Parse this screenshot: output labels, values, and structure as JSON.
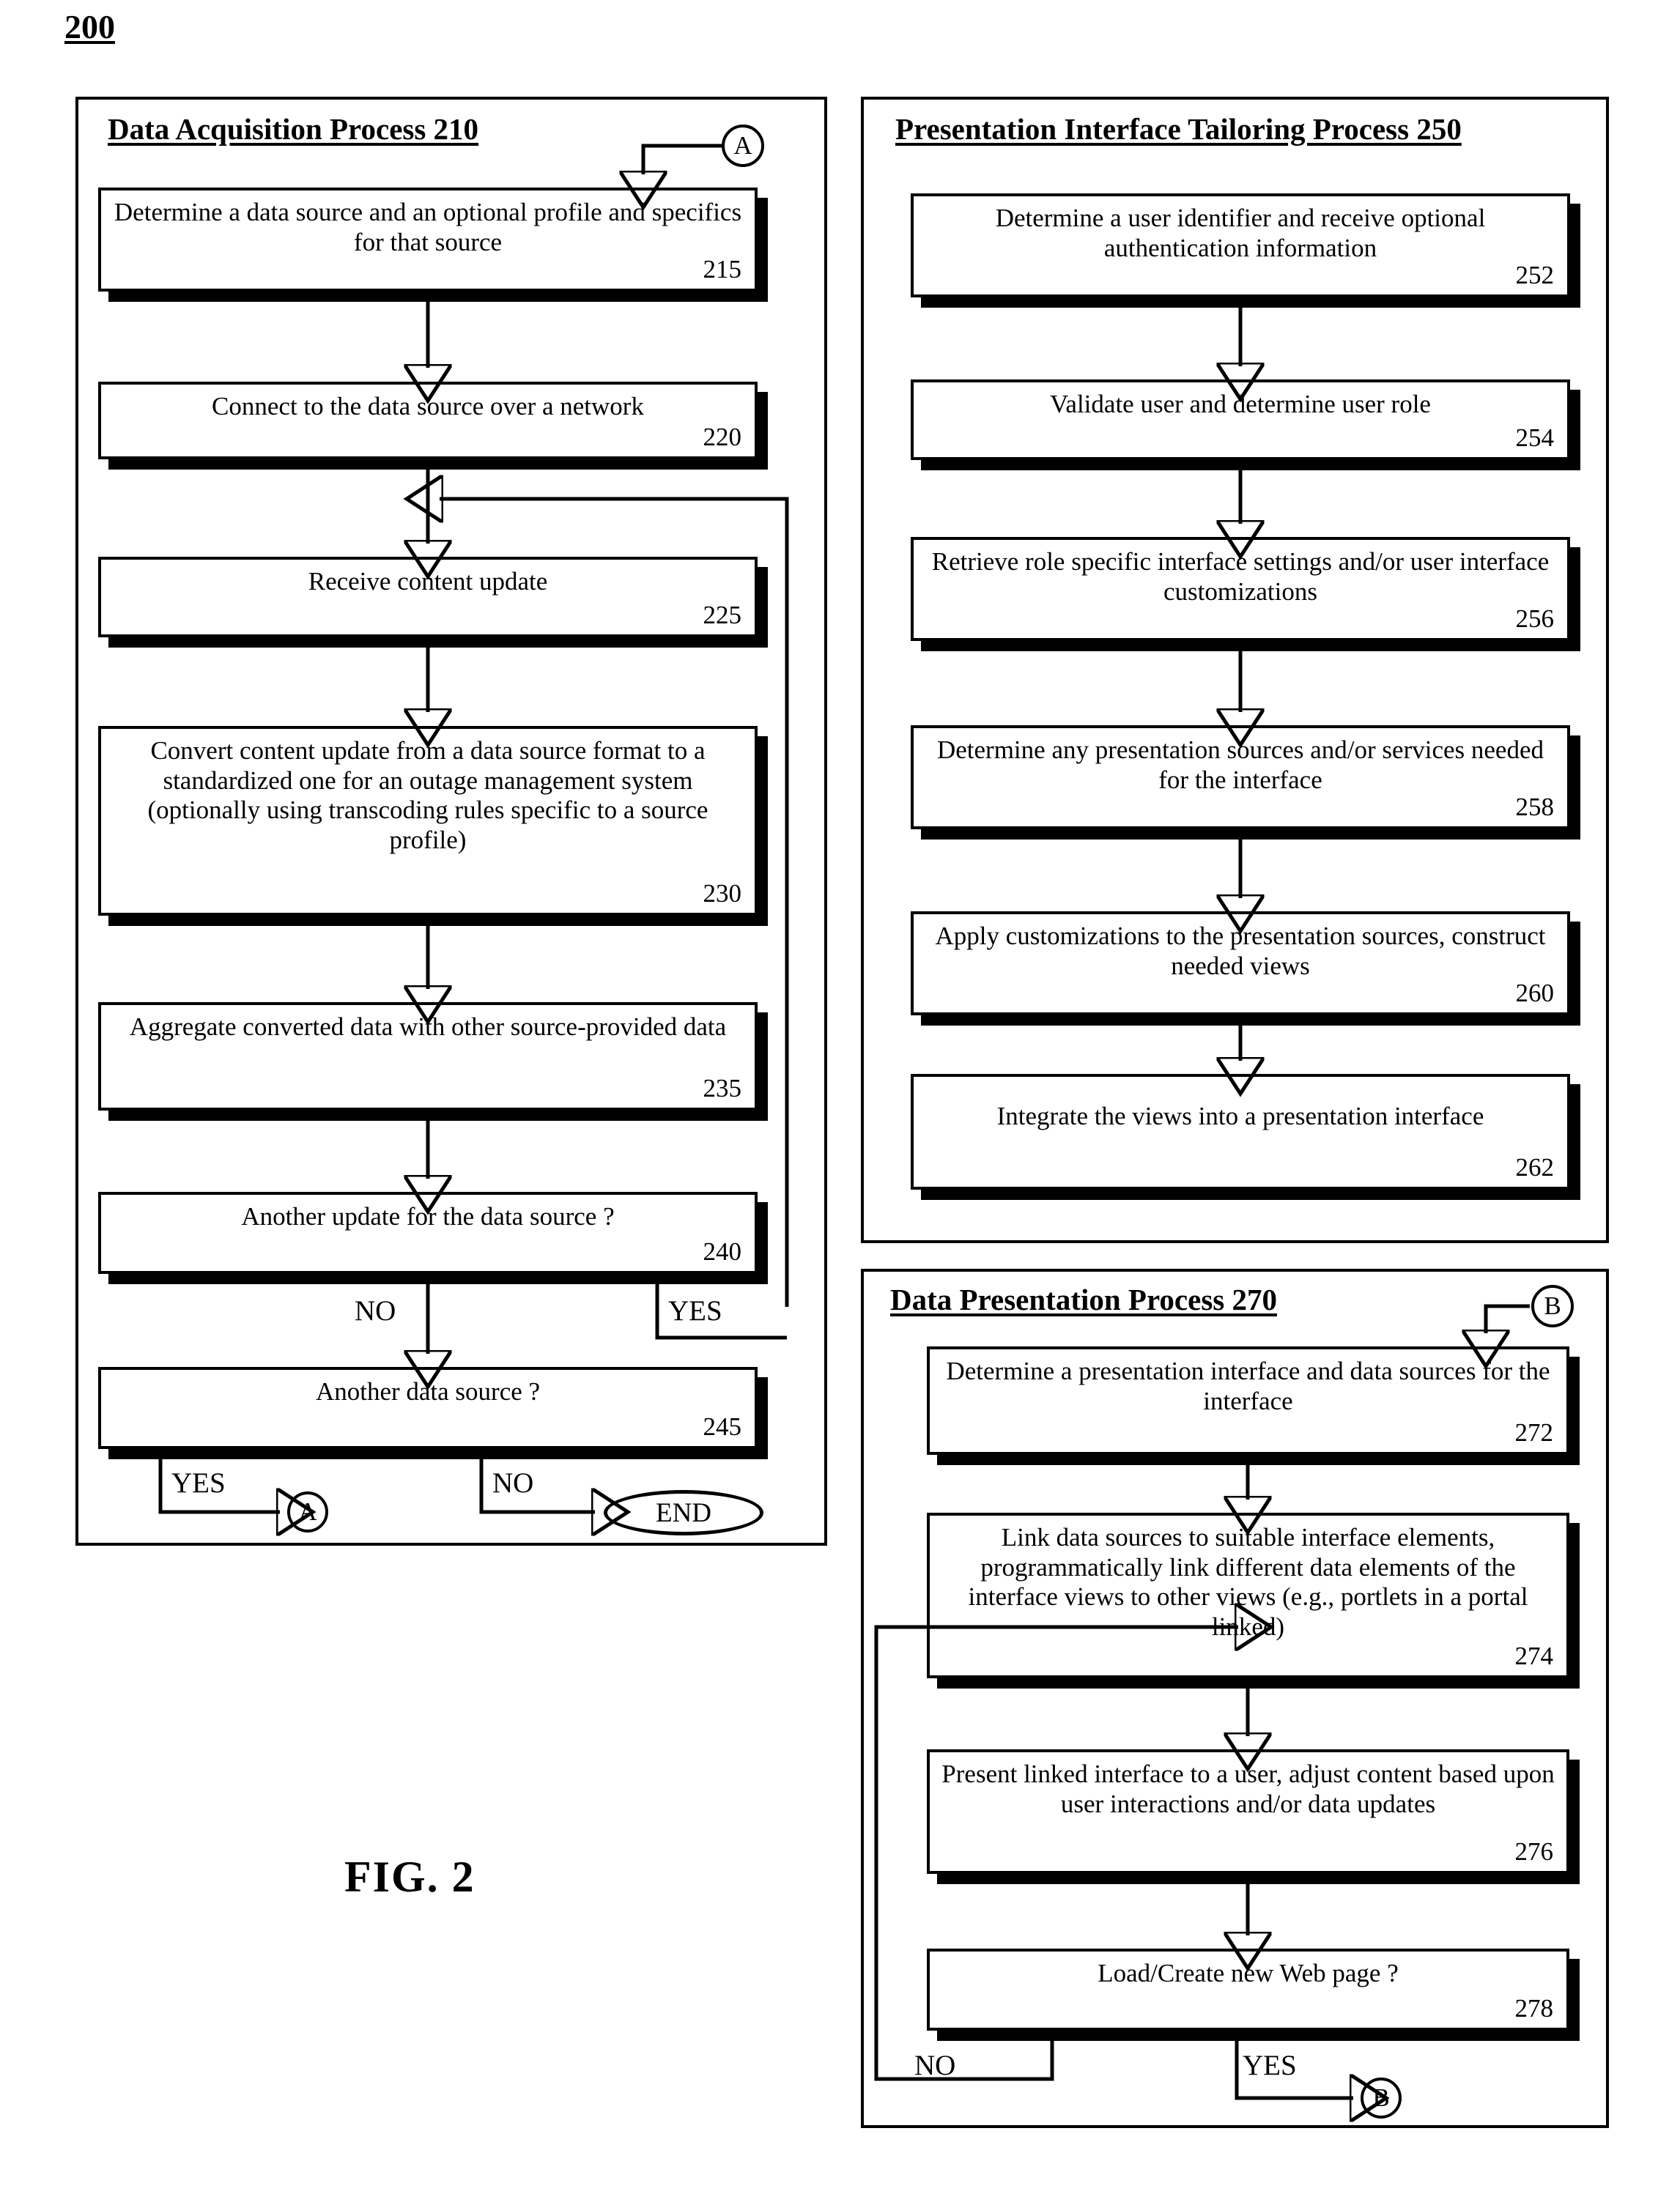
{
  "figure": {
    "number": "200",
    "caption": "FIG. 2"
  },
  "processes": [
    {
      "id": "data-acquisition",
      "title": "Data Acquisition Process 210",
      "connector_in": "A",
      "steps": [
        {
          "text": "Determine a data source and an optional profile and specifics for that source",
          "num": "215"
        },
        {
          "text": "Connect to the data source over a network",
          "num": "220"
        },
        {
          "text": "Receive content update",
          "num": "225"
        },
        {
          "text": "Convert content update from a data source format to a standardized one for an outage management system (optionally using transcoding rules specific to a source profile)",
          "num": "230"
        },
        {
          "text": "Aggregate converted data with other source-provided data",
          "num": "235"
        },
        {
          "text": "Another update for the data source ?",
          "num": "240"
        },
        {
          "text": "Another data source ?",
          "num": "245"
        }
      ],
      "branches": {
        "step240_no": "NO",
        "step240_yes": "YES",
        "step245_yes": "YES",
        "step245_no": "NO"
      },
      "terminators": {
        "loop_connector": "A",
        "end": "END"
      }
    },
    {
      "id": "presentation-interface-tailoring",
      "title": "Presentation Interface Tailoring Process 250",
      "steps": [
        {
          "text": "Determine a user identifier and receive optional authentication information",
          "num": "252"
        },
        {
          "text": "Validate user and determine user role",
          "num": "254"
        },
        {
          "text": "Retrieve role specific interface settings and/or user interface customizations",
          "num": "256"
        },
        {
          "text": "Determine any presentation sources and/or services needed for the interface",
          "num": "258"
        },
        {
          "text": "Apply customizations to the presentation sources, construct needed views",
          "num": "260"
        },
        {
          "text": "Integrate the views into a presentation interface",
          "num": "262"
        }
      ]
    },
    {
      "id": "data-presentation",
      "title": "Data Presentation Process 270",
      "connector_in": "B",
      "steps": [
        {
          "text": "Determine a presentation interface and data sources for the interface",
          "num": "272"
        },
        {
          "text": "Link data sources to suitable interface elements, programmatically link different data elements of the interface views to other views (e.g., portlets in a portal linked)",
          "num": "274"
        },
        {
          "text": "Present linked interface to a user, adjust content based upon user interactions and/or data updates",
          "num": "276"
        },
        {
          "text": "Load/Create new Web page ?",
          "num": "278"
        }
      ],
      "branches": {
        "step278_no": "NO",
        "step278_yes": "YES"
      },
      "terminators": {
        "loop_connector": "B"
      }
    }
  ],
  "colors": {
    "stroke": "#000000",
    "fill": "#ffffff"
  }
}
